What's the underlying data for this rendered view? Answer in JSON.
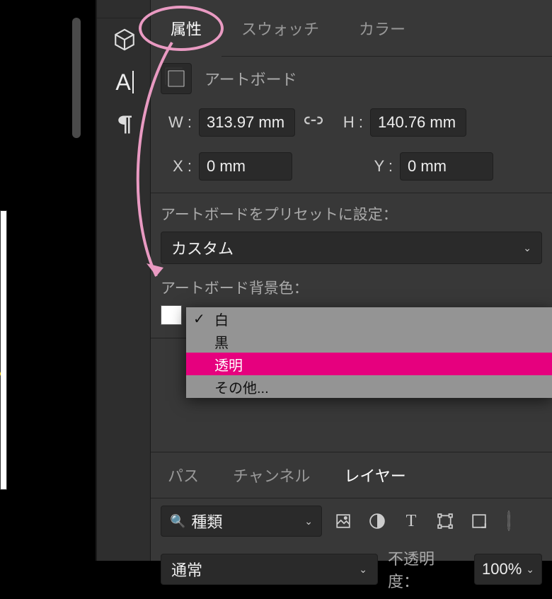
{
  "tabs_top": {
    "properties": "属性",
    "swatches": "スウォッチ",
    "color": "カラー",
    "active": 0
  },
  "artboard": {
    "label": "アートボード",
    "w_label": "W :",
    "w_value": "313.97 mm",
    "h_label": "H :",
    "h_value": "140.76 mm",
    "x_label": "X :",
    "x_value": "0 mm",
    "y_label": "Y :",
    "y_value": "0 mm",
    "preset_label": "アートボードをプリセットに設定：",
    "preset_value": "カスタム",
    "bg_label": "アートボード背景色："
  },
  "bg_dropdown": {
    "items": [
      "白",
      "黒",
      "透明",
      "その他..."
    ],
    "checked_index": 0,
    "highlighted_index": 2
  },
  "tabs_bottom": {
    "paths": "パス",
    "channels": "チャンネル",
    "layers": "レイヤー",
    "active": 2
  },
  "layers": {
    "filter_label": "種類",
    "blend_mode": "通常",
    "opacity_label": "不透明度：",
    "opacity_value": "100%"
  },
  "icons": {
    "cube": "cube-3d-icon",
    "type": "A",
    "paragraph": "¶",
    "link": "⛓",
    "search": "🔍",
    "caret": "⌄",
    "image": "img",
    "adjust": "adj",
    "text": "T",
    "shape": "shape",
    "smart": "smart"
  }
}
